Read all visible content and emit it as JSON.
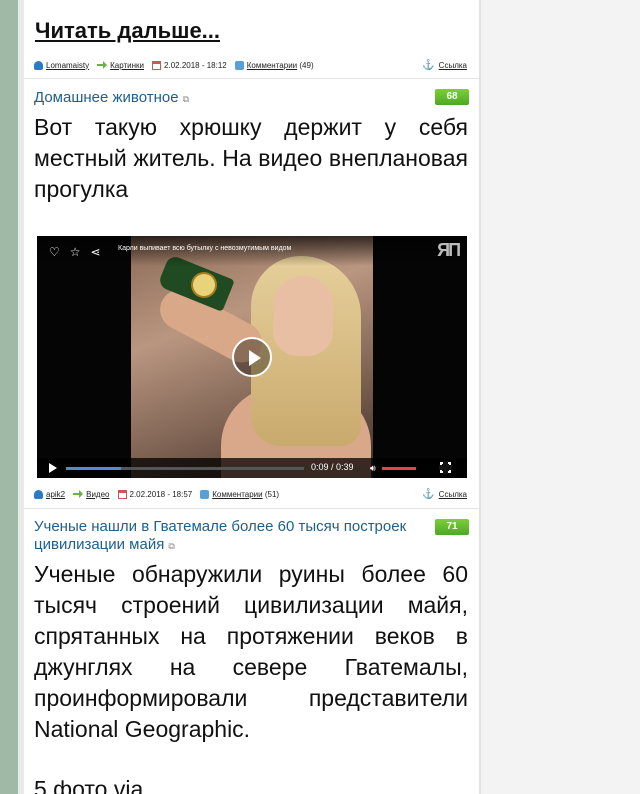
{
  "read_more": "Читать дальше...",
  "post1": {
    "meta": {
      "author": "Lomamaisty",
      "category": "Картинки",
      "date": "2.02.2018 - 18:12",
      "comments": "Комментарии",
      "comments_count": "(49)",
      "share": "Ссылка"
    }
  },
  "post2": {
    "category_title": "Домашнее животное",
    "score": "68",
    "text": "Вот такую хрюшку держит у себя местный житель. На видео внеплановая прогулка",
    "video": {
      "title": "Карли выпивает всю бутылку с невозмутимым видом",
      "logo": "ЯП",
      "time": "0:09 / 0:39",
      "progress": 0.23,
      "volume": 1.0
    },
    "meta": {
      "author": "apik2",
      "category": "Видео",
      "date": "2.02.2018 - 18:57",
      "comments": "Комментарии",
      "comments_count": "(51)",
      "share": "Ссылка"
    }
  },
  "post3": {
    "category_title": "Ученые нашли в Гватемале более 60 тысяч построек цивилизации майя",
    "score": "71",
    "text": "Ученые обнаружили руины более 60 тысяч строений цивилизации майя, спрятанных на протяжении веков в джунглях на севере Гватемалы, проинформировали представители National Geographic.",
    "footer_text": "5 фото via"
  },
  "colors": {
    "score_green": "#5cb82c",
    "link_blue": "#1f5f8b",
    "left_rail": "#9fb9a6",
    "volume_red": "#e04848",
    "progress_blue": "#4a8fd6"
  }
}
